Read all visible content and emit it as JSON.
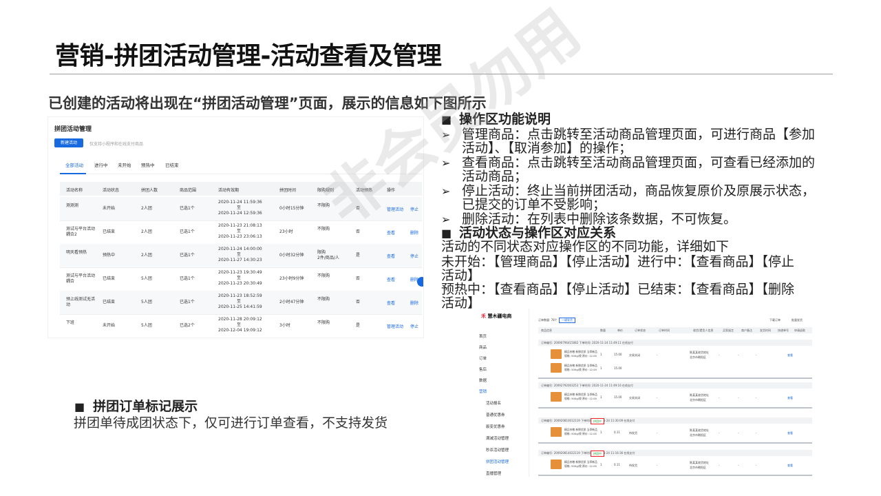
{
  "title": "营销-拼团活动管理-活动查看及管理",
  "subtitle": "已创建的活动将出现在“拼团活动管理”页面，展示的信息如下图所示",
  "screenshot_list": {
    "title": "拼团活动管理",
    "new_button": "新建活动",
    "hint": "仅支持小程序和在线支付商品",
    "tabs": [
      "全部活动",
      "进行中",
      "未开始",
      "预热中",
      "已结束"
    ],
    "columns": [
      "活动名称",
      "活动状态",
      "拼团人数",
      "商品范围",
      "活动有效期",
      "拼团时间",
      "限购规则",
      "活动预热",
      "操作"
    ],
    "rows": [
      {
        "name": "测测测",
        "status": "未开始",
        "people": "2人团",
        "range": "已选1个",
        "start": "2020-11-24 11:59:36",
        "to": "至",
        "end": "2020-11-24 12:59:36",
        "time": "0小时15分钟",
        "limit": "不限购",
        "limit2": "",
        "preheat": "否",
        "op1": "管理活动",
        "op2": "停止"
      },
      {
        "name": "测试与平台活动耦合2",
        "status": "已结束",
        "people": "2人团",
        "range": "已选1个",
        "start": "2020-11-23 21:08:13",
        "to": "至",
        "end": "2020-11-23 23:06:13",
        "time": "23小时",
        "limit": "不限购",
        "limit2": "",
        "preheat": "否",
        "op1": "查看",
        "op2": "删除"
      },
      {
        "name": "明天看预热",
        "status": "预热中",
        "people": "2人团",
        "range": "已选1个",
        "start": "2020-11-24 14:00:00",
        "to": "至",
        "end": "2020-11-27 14:30:23",
        "time": "0小时32分钟",
        "limit": "限购",
        "limit2": "2件/商品/人",
        "preheat": "是",
        "op1": "查看",
        "op2": "停止"
      },
      {
        "name": "测试与平台活动耦合",
        "status": "已结束",
        "people": "5人团",
        "range": "已选1个",
        "start": "2020-11-23 19:30:49",
        "to": "至",
        "end": "2020-11-23 20:30:49",
        "time": "23小时9分钟",
        "limit": "不限购",
        "limit2": "",
        "preheat": "否",
        "op1": "查看",
        "op2": "删除"
      },
      {
        "name": "预上线测试无活动",
        "status": "已结束",
        "people": "5人团",
        "range": "已选1个",
        "start": "2020-11-23 18:52:59",
        "to": "至",
        "end": "2020-11-25 14:41:59",
        "time": "2小时47分钟",
        "limit": "不限购",
        "limit2": "",
        "preheat": "否",
        "op1": "查看",
        "op2": "删除"
      },
      {
        "name": "下班",
        "status": "未开始",
        "people": "5人团",
        "range": "已选2个",
        "start": "2020-11-28 20:09:12",
        "to": "至",
        "end": "2020-12-04 19:09:12",
        "time": "3小时",
        "limit": "不限购",
        "limit2": "",
        "preheat": "是",
        "op1": "管理活动",
        "op2": "停止"
      }
    ]
  },
  "right": {
    "h1": "操作区功能说明",
    "items": [
      {
        "l1": "管理商品：点击跳转至活动商品管理页面，可进行商品【参加",
        "l2": "活动】、【取消参加】的操作；"
      },
      {
        "l1": "查看商品：点击跳转至活动商品管理页面，可查看已经添加的",
        "l2": "活动商品；"
      },
      {
        "l1": "停止活动：终止当前拼团活动，商品恢复原价及原展示状态，",
        "l2": "已提交的订单不受影响；"
      },
      {
        "l1": "删除活动：在列表中删除该条数据，不可恢复。",
        "l2": ""
      }
    ],
    "h2": "活动状态与操作区对应关系",
    "p1": "活动的不同状态对应操作区的不同功能，详细如下",
    "p2a": "未开始：【管理商品】【停止活动】进行中：【查看商品】【停止",
    "p2b": "活动】",
    "p3a": "预热中：【查看商品】【停止活动】已结束：【查看商品】【删除",
    "p3b": "活动】"
  },
  "order": {
    "heading": "拼团订单标记展示",
    "desc": "拼团单待成团状态下，仅可进行订单查看，不支持发货"
  },
  "screenshot_orders": {
    "logo_icon": "禾",
    "logo": "慧木疆电商",
    "nav": [
      "首页",
      "商品",
      "订单",
      "售后",
      "数据",
      "营销",
      "活动报名",
      "普通优惠券",
      "裂变优惠券",
      "满减活动管理",
      "秒杀活动管理",
      "拼团活动管理",
      "直播管理"
    ],
    "order_count": "订单数量: 78个",
    "export": "一键发货",
    "top_right": [
      "下载订单",
      "批量发货"
    ],
    "cols": [
      "商品信息",
      "数量",
      "单价",
      "订单状态",
      "订单时间",
      "收货/提货人信息",
      "买家留言",
      "商户备注",
      "发货时间",
      "快递单号",
      "申请退款"
    ],
    "orders": [
      {
        "no": "订单编号: 20090796415082    下单时间: 2020-11-24 11:49:11    在线支付",
        "tag": ""
      },
      {
        "no": "订单编号: 20092792003253    下单时间: 2020-11-24 11:49:16    在线支付",
        "tag": ""
      },
      {
        "no": "订单编号: 200920810012119    下单时间: 2020-11-24 11:30:09    在线支付",
        "tag": "拼团中"
      },
      {
        "no": "订单编号: 200920814022119    下单时间: 2020-11-24 11:16:36    在线支付",
        "tag": "拼团中"
      }
    ],
    "product_text1": "精品杂粮 新鲜优质 当季新品",
    "product_text2": "规格: 500g/袋 原价: 12.00",
    "qty": "1",
    "price1": "15.00",
    "price2": "0.11",
    "state1": "交易关闭",
    "state2": "待发货",
    "buyer1": "陈某某收货地址",
    "buyer2": "北京市朝阳区",
    "link": "查看",
    "dash": "-"
  },
  "watermark": "非会员勿用"
}
